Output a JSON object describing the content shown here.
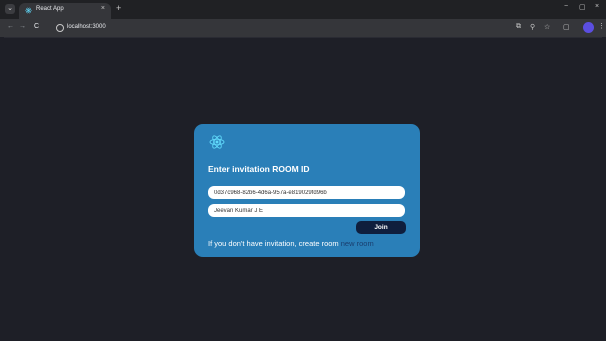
{
  "browser": {
    "tab_title": "React App",
    "tab_close": "×",
    "new_tab": "+",
    "url": "localhost:3000",
    "nav_back": "←",
    "nav_forward": "→",
    "nav_reload": "C"
  },
  "window": {
    "minimize": "−",
    "maximize": "▢",
    "close": "×"
  },
  "card": {
    "title": "Enter invitation ROOM ID",
    "room_id_value": "0d37c968-82b6-4d6a-957a-e819029fd96b",
    "name_value": "Jeevan Kumar J E",
    "join_label": "Join",
    "footer_text": "If you don't have invitation, create room",
    "footer_link": "new room"
  },
  "colors": {
    "background": "#1e1f27",
    "card": "#2a7fb8",
    "join_button": "#0f1e3d",
    "link": "#1a3e6e",
    "react_logo": "#61dafb"
  }
}
